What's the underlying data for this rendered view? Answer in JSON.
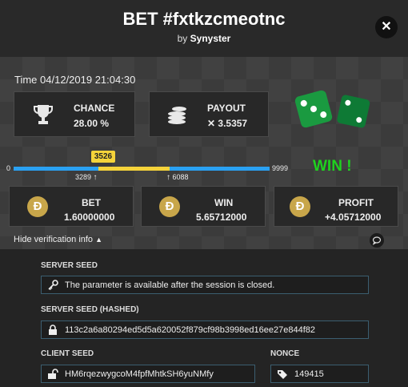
{
  "header": {
    "title": "BET #fxtkzcmeotnc",
    "by_prefix": "by",
    "author": "Synyster",
    "close_icon": "✕"
  },
  "main": {
    "time_label": "Time",
    "time_value": "04/12/2019 21:04:30",
    "chance": {
      "label": "CHANCE",
      "value": "28.00 %",
      "icon": "trophy-icon"
    },
    "payout": {
      "label": "PAYOUT",
      "value": "✕ 3.5357",
      "icon": "coins-icon"
    },
    "result_label": "WIN !",
    "slider": {
      "min": "0",
      "max": "9999",
      "range_start": "3289",
      "range_end": "6088",
      "result": "3526",
      "result_fraction": 0.3526,
      "range_start_fraction": 0.3289,
      "range_end_fraction": 0.6088
    },
    "bet": {
      "label": "BET",
      "value": "1.60000000",
      "icon": "doge-icon",
      "currency_symbol": "Ð"
    },
    "win": {
      "label": "WIN",
      "value": "5.65712000",
      "icon": "doge-icon",
      "currency_symbol": "Ð"
    },
    "profit": {
      "label": "PROFIT",
      "value": "+4.05712000",
      "icon": "doge-icon",
      "currency_symbol": "Ð"
    },
    "hide_verification": "Hide verification info"
  },
  "verification": {
    "server_seed_label": "SERVER SEED",
    "server_seed_value": "The parameter is available after the session is closed.",
    "server_seed_hashed_label": "SERVER SEED (HASHED)",
    "server_seed_hashed_value": "113c2a6a80294ed5d5a620052f879cf98b3998ed16ee27e844f82",
    "client_seed_label": "CLIENT SEED",
    "client_seed_value": "HM6rqezwygcoM4fpfMhtkSH6yuNMfy",
    "nonce_label": "NONCE",
    "nonce_value": "149415"
  },
  "colors": {
    "accent_blue": "#2aa1f2",
    "highlight_yellow": "#f5d33a",
    "win_green": "#1fd21f",
    "dice_green": "#1a8a3c",
    "doge_gold": "#c8a64a"
  }
}
